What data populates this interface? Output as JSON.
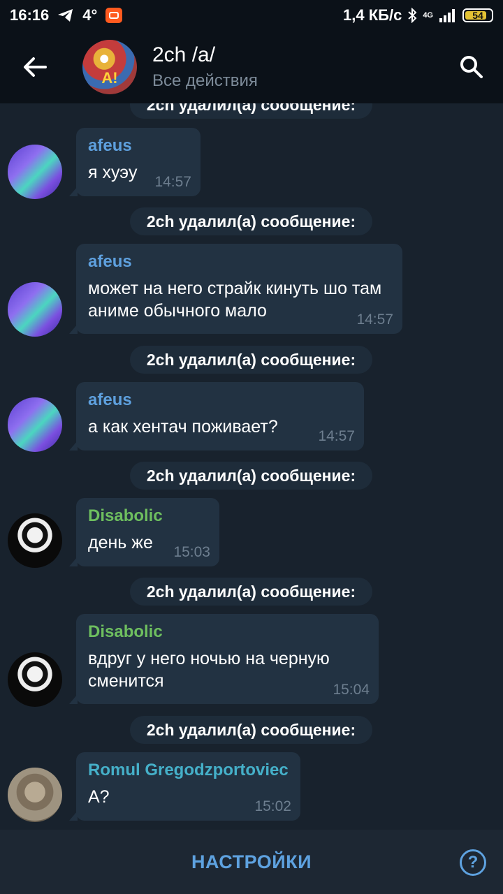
{
  "status_bar": {
    "time": "16:16",
    "temperature": "4°",
    "network_speed": "1,4 КБ/с",
    "network_type": "4G",
    "battery": "54",
    "battery_level_percent": 54
  },
  "header": {
    "title": "2ch /a/",
    "subtitle": "Все действия",
    "avatar_badge": "A!"
  },
  "service_message": "2ch удалил(а) сообщение:",
  "messages": [
    {
      "sender": "afeus",
      "text": "я хуэу",
      "time": "14:57"
    },
    {
      "sender": "afeus",
      "text": "может на него страйк кинуть шо там аниме обычного мало",
      "time": "14:57"
    },
    {
      "sender": "afeus",
      "text": "а как хентач поживает?",
      "time": "14:57"
    },
    {
      "sender": "Disabolic",
      "text": "день же",
      "time": "15:03"
    },
    {
      "sender": "Disabolic",
      "text": "вдруг у него ночью на черную сменится",
      "time": "15:04"
    },
    {
      "sender": "Romul Gregodzportoviec",
      "text": "А?",
      "time": "15:02"
    }
  ],
  "bottom_bar": {
    "settings_label": "НАСТРОЙКИ",
    "help_glyph": "?"
  },
  "colors": {
    "background": "#18222d",
    "bubble": "#223242",
    "afeus_name": "#5ea0de",
    "disabolic_name": "#6ebf5f",
    "romul_name": "#45b0c9",
    "accent": "#5ea2e0"
  },
  "icons": [
    "telegram-icon",
    "recorder-icon",
    "bluetooth-icon",
    "signal-icon",
    "battery-icon",
    "back-arrow-icon",
    "search-icon",
    "help-icon"
  ]
}
